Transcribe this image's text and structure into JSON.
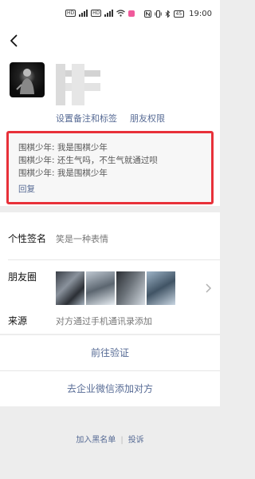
{
  "status_bar": {
    "left_badges": [
      "HD",
      "HD"
    ],
    "time": "19:00",
    "battery": "45"
  },
  "profile": {
    "set_remark_label": "设置备注和标签",
    "friend_permission_label": "朋友权限"
  },
  "messages": [
    "围棋少年: 我是围棋少年",
    "围棋少年: 还生气吗，不生气就通过呗",
    "围棋少年: 我是围棋少年"
  ],
  "reply_label": "回复",
  "signature": {
    "label": "个性签名",
    "value": "笑是一种表情"
  },
  "moments": {
    "label": "朋友圈"
  },
  "source": {
    "label": "来源",
    "value": "对方通过手机通讯录添加"
  },
  "actions": {
    "verify": "前往验证",
    "enterprise_add": "去企业微信添加对方"
  },
  "footer": {
    "blacklist": "加入黑名单",
    "report": "投诉"
  },
  "colors": {
    "link": "#576b95",
    "highlight_border": "#e8313a"
  }
}
